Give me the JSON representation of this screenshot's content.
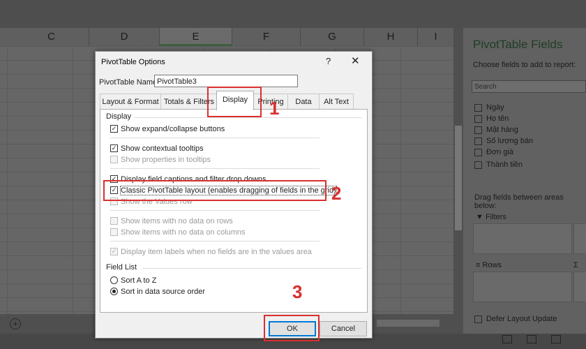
{
  "spreadsheet": {
    "columns": [
      "C",
      "D",
      "E",
      "F",
      "G",
      "H",
      "I"
    ],
    "selected_column": "E"
  },
  "pivot_pane": {
    "title": "PivotTable Fields",
    "subtitle": "Choose fields to add to report:",
    "search_placeholder": "Search",
    "fields": [
      "Ngày",
      "Họ tên",
      "Mặt hàng",
      "Số lượng bán",
      "Đơn giá",
      "Thành tiền"
    ],
    "drag_label": "Drag fields between areas below:",
    "areas": {
      "filters": "Filters",
      "rows": "Rows",
      "values_symbol": "Σ"
    },
    "defer_label": "Defer Layout Update"
  },
  "dialog": {
    "title": "PivotTable Options",
    "help": "?",
    "close": "✕",
    "name_label": "PivotTable Name:",
    "name_value": "PivotTable3",
    "tabs": [
      "Layout & Format",
      "Totals & Filters",
      "Display",
      "Printing",
      "Data",
      "Alt Text"
    ],
    "active_tab": "Display",
    "display_section": "Display",
    "options": {
      "expand_collapse": "Show expand/collapse buttons",
      "tooltips": "Show contextual tooltips",
      "properties": "Show properties in tooltips",
      "field_captions": "Display field captions and filter drop downs",
      "classic_layout": "Classic PivotTable layout (enables dragging of fields in the grid)",
      "values_row": "Show the Values row",
      "items_rows": "Show items with no data on rows",
      "items_columns": "Show items with no data on columns",
      "item_labels": "Display item labels when no fields are in the values area"
    },
    "field_list_section": "Field List",
    "sort_a_to_z": "Sort A to Z",
    "sort_source": "Sort in data source order",
    "ok": "OK",
    "cancel": "Cancel",
    "check_mark": "✓"
  },
  "annotations": {
    "step1": "1",
    "step2": "2",
    "step3": "3"
  },
  "colors": {
    "annotation_red": "#d92f2f",
    "pane_title_green": "#1f3d24",
    "default_button_blue": "#0078d7"
  }
}
